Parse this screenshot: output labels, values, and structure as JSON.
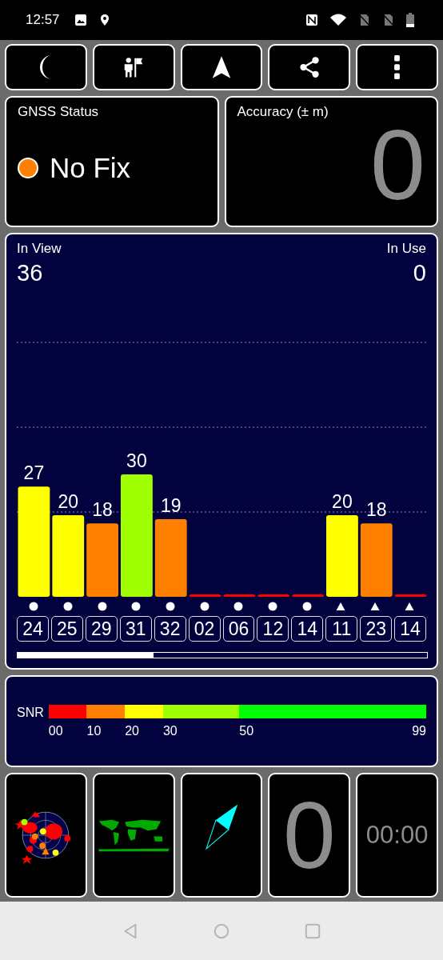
{
  "status_bar": {
    "time": "12:57"
  },
  "gnss": {
    "title": "GNSS Status",
    "status": "No Fix",
    "color": "#ff8000"
  },
  "accuracy": {
    "title": "Accuracy (± m)",
    "value": "0"
  },
  "sky": {
    "in_view_label": "In View",
    "in_view": "36",
    "in_use_label": "In Use",
    "in_use": "0",
    "chart_data": {
      "type": "bar",
      "categories": [
        "24",
        "25",
        "29",
        "31",
        "32",
        "02",
        "06",
        "12",
        "14",
        "11",
        "23",
        "14"
      ],
      "values": [
        27,
        20,
        18,
        30,
        19,
        0,
        0,
        0,
        0,
        20,
        18,
        0
      ],
      "value_labels": [
        "27",
        "20",
        "18",
        "30",
        "19",
        null,
        null,
        null,
        null,
        "20",
        "18",
        null
      ]
    },
    "markers": [
      {
        "kind": "circle"
      },
      {
        "kind": "circle"
      },
      {
        "kind": "circle"
      },
      {
        "kind": "circle"
      },
      {
        "kind": "circle"
      },
      {
        "kind": "circle"
      },
      {
        "kind": "circle"
      },
      {
        "kind": "circle"
      },
      {
        "kind": "circle"
      },
      {
        "kind": "triangle"
      },
      {
        "kind": "triangle"
      },
      {
        "kind": "triangle"
      }
    ]
  },
  "snr": {
    "label": "SNR",
    "segments": [
      {
        "label": "00",
        "color": "#ff0000"
      },
      {
        "label": "10",
        "color": "#ff8000"
      },
      {
        "label": "20",
        "color": "#ffff00"
      },
      {
        "label": "30",
        "color": "#a0ff00"
      },
      {
        "label": "50",
        "color": "#00ff00"
      }
    ],
    "end_label": "99"
  },
  "speed": {
    "value": "0"
  },
  "timer": {
    "value": "00:00"
  }
}
